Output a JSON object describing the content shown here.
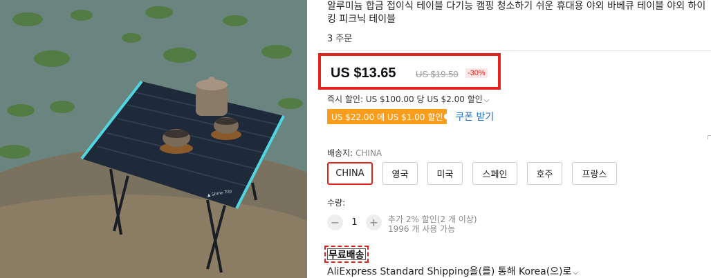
{
  "product": {
    "title": "알루미늄 합금 접이식 테이블 다기능 캠핑 청소하기 쉬운 휴대용 야외 바베큐 테이블 야외 하이킹 피크닉 테이블",
    "orders": "3 주문",
    "image_alt": "folding aluminum camping table on rock by water",
    "image_logo_text": "Shine Trip"
  },
  "price": {
    "current": "US $13.65",
    "original": "US $19.50",
    "discount": "-30%"
  },
  "promotions": {
    "instant_discount": "즉시 할인: US $100.00 당 US $2.00 할인",
    "coupon_badge": "US $22.00 에 US $1.00 할인",
    "coupon_link": "쿠폰 받기"
  },
  "ship_from": {
    "label": "배송지:",
    "value": "CHINA",
    "options": [
      "CHINA",
      "영국",
      "미국",
      "스페인",
      "호주",
      "프랑스"
    ],
    "selected": "CHINA"
  },
  "quantity": {
    "label": "수량:",
    "minus": "−",
    "value": "1",
    "plus": "+",
    "bulk_note": "추가 2% 할인(2 개 이상)",
    "available": "1996 개 사용 가능"
  },
  "shipping": {
    "free_label": "무료배송",
    "method": "AliExpress Standard Shipping을(를) 통해 Korea(으)로"
  },
  "colors": {
    "accent_red": "#e0231c",
    "coupon_orange": "#fa9d1a",
    "link_blue": "#1a6ec8"
  },
  "icons": [
    "chevron-down-icon"
  ]
}
